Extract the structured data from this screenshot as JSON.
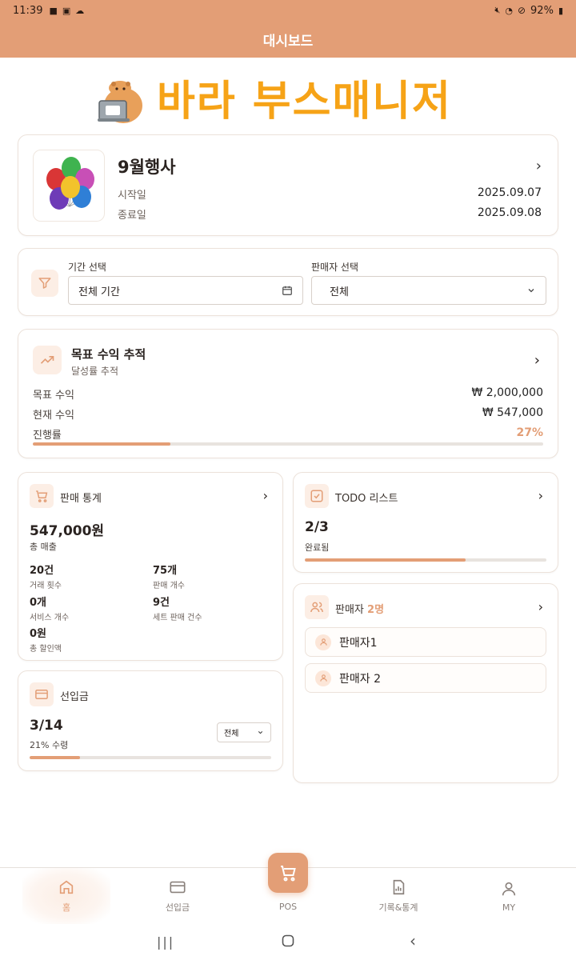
{
  "status_bar": {
    "time": "11:39",
    "battery": "92%"
  },
  "app_bar": {
    "title": "대시보드"
  },
  "logo": {
    "text": "바라 부스매니저"
  },
  "event": {
    "name": "9월행사",
    "start_label": "시작일",
    "start_date": "2025.09.07",
    "end_label": "종료일",
    "end_date": "2025.09.08"
  },
  "filters": {
    "period_label": "기간 선택",
    "period_value": "전체 기간",
    "seller_label": "판매자 선택",
    "seller_value": "전체"
  },
  "goal": {
    "title": "목표 수익 추적",
    "subtitle": "달성률 추적",
    "target_label": "목표 수익",
    "target_value": "₩ 2,000,000",
    "current_label": "현재 수익",
    "current_value": "₩ 547,000",
    "progress_label": "진행률",
    "progress_text": "27%",
    "progress": 0.27
  },
  "sales": {
    "title": "판매 통계",
    "total": "547,000원",
    "total_label": "총 매출",
    "stats": [
      {
        "value": "20건",
        "label": "거래 횟수"
      },
      {
        "value": "75개",
        "label": "판매 개수"
      },
      {
        "value": "0개",
        "label": "서비스 개수"
      },
      {
        "value": "9건",
        "label": "세트 판매 건수"
      },
      {
        "value": "0원",
        "label": "총 할인액"
      }
    ]
  },
  "todo": {
    "title": "TODO 리스트",
    "value": "2/3",
    "label": "완료됨",
    "progress": 0.667
  },
  "sellers": {
    "title": "판매자",
    "count": "2명",
    "items": [
      "판매자1",
      "판매자 2"
    ]
  },
  "prepayment": {
    "title": "선입금",
    "value": "3/14",
    "label": "21% 수령",
    "filter_value": "전체",
    "progress": 0.21
  },
  "bottom_nav": {
    "home": "홈",
    "prepay": "선입금",
    "pos": "POS",
    "records": "기록&통계",
    "my": "MY"
  },
  "colors": {
    "accent": "#E39E76",
    "logo": "#F6A317",
    "accent_light": "#FCEEE5"
  }
}
